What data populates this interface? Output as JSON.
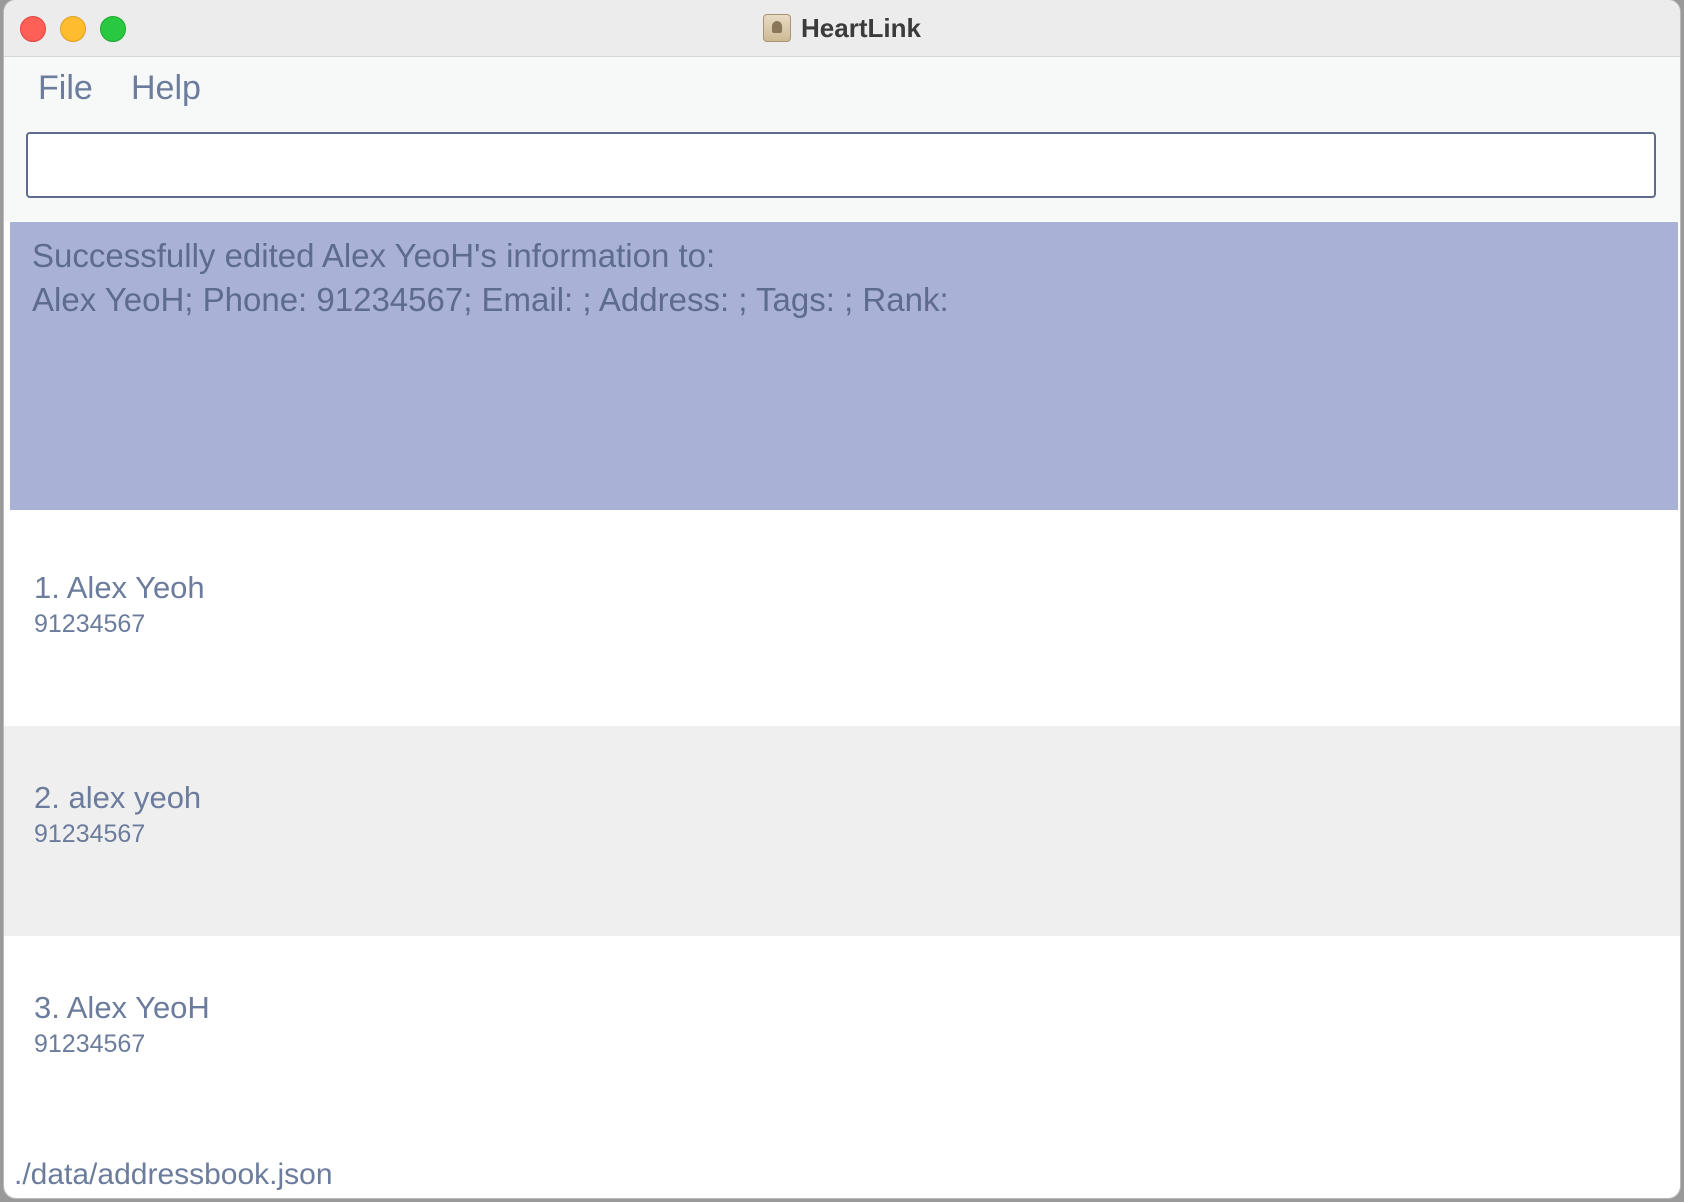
{
  "window": {
    "title": "HeartLink"
  },
  "menu": {
    "items": [
      "File",
      "Help"
    ]
  },
  "command": {
    "value": "",
    "placeholder": ""
  },
  "result": {
    "lines": [
      "Successfully edited Alex YeoH's information to:",
      "Alex YeoH; Phone: 91234567; Email: ; Address: ; Tags: ; Rank:"
    ]
  },
  "persons": [
    {
      "label": "1. Alex Yeoh",
      "phone": "91234567"
    },
    {
      "label": "2. alex yeoh",
      "phone": "91234567"
    },
    {
      "label": "3. Alex YeoH",
      "phone": "91234567"
    }
  ],
  "status": {
    "path": "./data/addressbook.json"
  },
  "colors": {
    "accent": "#6b7c9c",
    "result_bg": "#a9b1d6",
    "alt_row": "#efefef"
  }
}
